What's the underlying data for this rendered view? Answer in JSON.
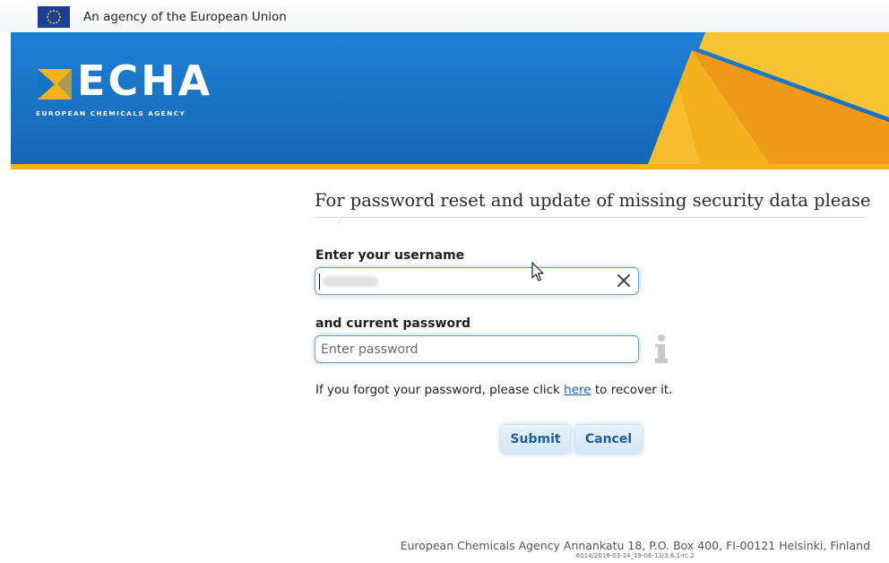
{
  "eu_bar": {
    "text": "An agency of the European Union"
  },
  "brand": {
    "logo_text": "ECHA",
    "logo_subtitle": "EUROPEAN CHEMICALS AGENCY",
    "primary_blue": "#1a72c4",
    "accent_yellow": "#f6b21a"
  },
  "form": {
    "heading": "For password reset and update of missing security data please",
    "username_label": "Enter your username",
    "password_label": "and current password",
    "password_placeholder": "Enter password",
    "forgot_prefix": "If you forgot your password, please click ",
    "forgot_link": "here",
    "forgot_suffix": " to recover it.",
    "submit_label": "Submit",
    "cancel_label": "Cancel"
  },
  "icons": {
    "clear": "close-icon",
    "info": "info-icon",
    "flag": "eu-flag-icon",
    "pointer": "mouse-pointer-icon"
  },
  "footer": {
    "address": "European Chemicals Agency Annankatu 18, P.O. Box 400, FI-00121 Helsinki, Finland",
    "version": "6014/2019-03-14_19-06-13/3.6.1-rc.2"
  }
}
